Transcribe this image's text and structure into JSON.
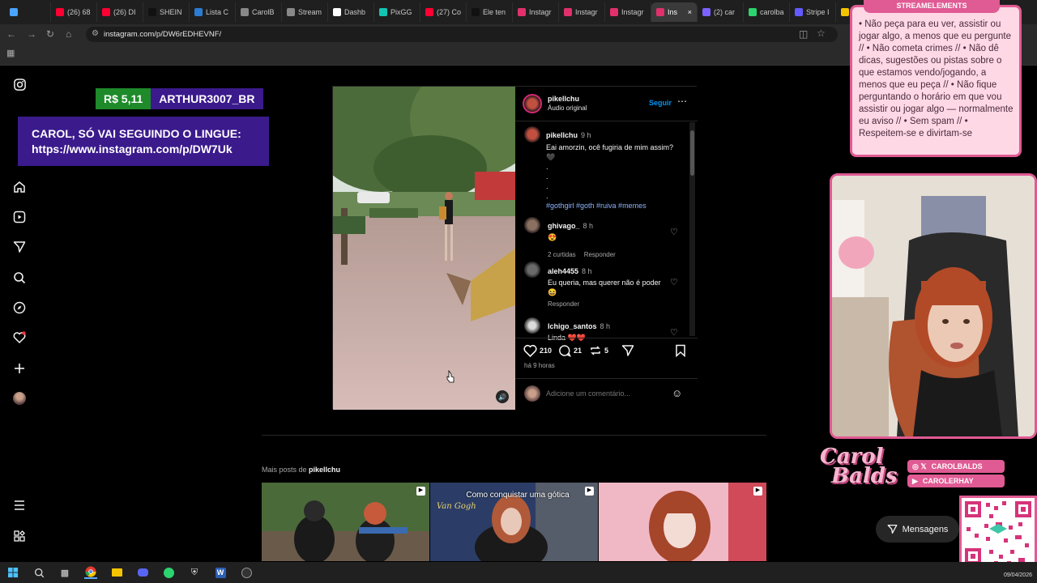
{
  "browser": {
    "tabs": [
      {
        "label": "",
        "color": "#4aa3ff"
      },
      {
        "label": "(26) 68",
        "color": "#ff0033"
      },
      {
        "label": "(26) DI",
        "color": "#ff0033"
      },
      {
        "label": "SHEIN",
        "color": "#111111"
      },
      {
        "label": "Lista C",
        "color": "#2b7cd3"
      },
      {
        "label": "CarolB",
        "color": "#888888"
      },
      {
        "label": "Stream",
        "color": "#888888"
      },
      {
        "label": "Dashb",
        "color": "#ffffff"
      },
      {
        "label": "PixGG",
        "color": "#12c6b3"
      },
      {
        "label": "(27) Co",
        "color": "#ff0033"
      },
      {
        "label": "Ele ten",
        "color": "#111111"
      },
      {
        "label": "Instagr",
        "color": "#e1306c"
      },
      {
        "label": "Instagr",
        "color": "#e1306c"
      },
      {
        "label": "Instagr",
        "color": "#e1306c"
      },
      {
        "label": "Ins",
        "color": "#e1306c",
        "active": true
      },
      {
        "label": "(2) car",
        "color": "#7b61ff"
      },
      {
        "label": "carolba",
        "color": "#2bd46e"
      },
      {
        "label": "Stripe I",
        "color": "#635bff"
      },
      {
        "label": "ca",
        "color": "#f5c400"
      }
    ],
    "url": "instagram.com/p/DW6rEDHEVNF/"
  },
  "overlay": {
    "donation_amount": "R$ 5,11",
    "donation_user": "ARTHUR3007_BR",
    "donation_message_line1": "CAROL, SÓ VAI SEGUINDO O LINGUE:",
    "donation_message_line2": "https://www.instagram.com/p/DW7Uk"
  },
  "post": {
    "author": "pikellchu",
    "audio": "Áudio original",
    "follow_label": "Seguir",
    "caption_author": "pikellchu",
    "caption_time": "9 h",
    "caption_text": "Eai amorzin, ocê fugiria de mim assim?",
    "caption_heart": "🖤",
    "caption_dots": [
      ".",
      ".",
      ".",
      "."
    ],
    "caption_tags": "#gothgirl #goth #ruiva #memes",
    "comments": [
      {
        "user": "ghivago_",
        "time": "8 h",
        "text": "😍",
        "likes": "2 curtidas",
        "reply": "Responder"
      },
      {
        "user": "aleh4455",
        "time": "8 h",
        "text": "Eu queria, mas querer não é poder",
        "text2": "😆",
        "reply": "Responder"
      },
      {
        "user": "Ichigo_santos",
        "time": "8 h",
        "text": "Linda ❤️❤️"
      }
    ],
    "likes": "210",
    "comment_count": "21",
    "reposts": "5",
    "posted_ago": "há 9 horas",
    "comment_placeholder": "Adicione um comentário..."
  },
  "more_posts": {
    "label_prefix": "Mais posts de",
    "label_user": "pikellchu",
    "thumb2_caption": "Como conquistar uma gótica",
    "thumb2_sign": "Van Gogh"
  },
  "stream": {
    "badge": "STREAMELEMENTS",
    "rules": "• Não peça para eu ver, assistir ou jogar algo, a menos que eu pergunte // • Não cometa crimes // • Não dê dicas, sugestões ou pistas sobre o que estamos vendo/jogando, a menos que eu peça // • Não fique perguntando o horário em que vou assistir ou jogar algo — normalmente eu aviso // • Sem spam // • Respeitem-se e divirtam-se",
    "brand_name_1": "Carol",
    "brand_name_2": "Balds",
    "handle_1": "CAROLBALDS",
    "handle_2": "CAROLERHAY",
    "messages_label": "Mensagens"
  },
  "taskbar": {
    "date": "09/04/2026"
  },
  "colors": {
    "ig_blue": "#0095f6",
    "pink_accent": "#e05a93",
    "donation_green": "#1e8a2a",
    "donation_purple": "#3b1a8c"
  }
}
